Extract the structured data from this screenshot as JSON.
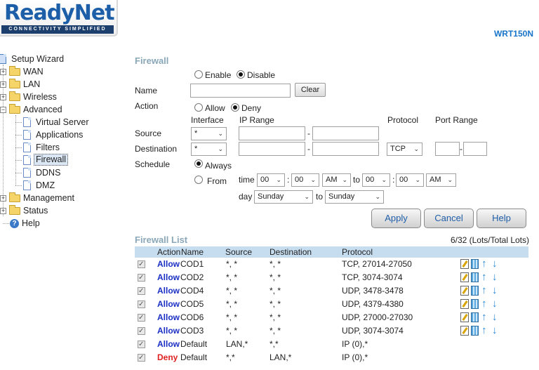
{
  "header": {
    "logo_text_1": "Ready",
    "logo_text_2": "Net",
    "logo_tagline": "CONNECTIVITY SIMPLIFIED",
    "model": "WRT150N"
  },
  "sidebar": {
    "setup_wizard": "Setup Wizard",
    "wan": "WAN",
    "lan": "LAN",
    "wireless": "Wireless",
    "advanced": "Advanced",
    "virtual_server": "Virtual Server",
    "applications": "Applications",
    "filters": "Filters",
    "firewall": "Firewall",
    "ddns": "DDNS",
    "dmz": "DMZ",
    "management": "Management",
    "status": "Status",
    "help": "Help"
  },
  "form": {
    "title": "Firewall",
    "enable": "Enable",
    "disable": "Disable",
    "name_label": "Name",
    "name_value": "",
    "clear": "Clear",
    "action_label": "Action",
    "allow": "Allow",
    "deny": "Deny",
    "col_interface": "Interface",
    "col_ip_range": "IP Range",
    "col_protocol": "Protocol",
    "col_port_range": "Port Range",
    "source_label": "Source",
    "destination_label": "Destination",
    "source_interface": "*",
    "destination_interface": "*",
    "dash": "-",
    "protocol": "TCP",
    "schedule_label": "Schedule",
    "always": "Always",
    "from": "From",
    "time_label": "time",
    "to": "to",
    "colon": ":",
    "hour_from": "00",
    "min_from": "00",
    "ampm_from": "AM",
    "hour_to": "00",
    "min_to": "00",
    "ampm_to": "AM",
    "day_label": "day",
    "day_from": "Sunday",
    "day_to": "Sunday"
  },
  "buttons": {
    "apply": "Apply",
    "cancel": "Cancel",
    "help": "Help"
  },
  "list": {
    "title": "Firewall List",
    "lots": "6/32 (Lots/Total Lots)",
    "headers": {
      "action": "Action",
      "name": "Name",
      "source": "Source",
      "destination": "Destination",
      "protocol": "Protocol"
    },
    "rows": [
      {
        "action": "Allow",
        "name": "COD1",
        "source": "*, *",
        "destination": "*, *",
        "protocol": "TCP, 27014-27050",
        "icons": true
      },
      {
        "action": "Allow",
        "name": "COD2",
        "source": "*, *",
        "destination": "*, *",
        "protocol": "TCP, 3074-3074",
        "icons": true
      },
      {
        "action": "Allow",
        "name": "COD4",
        "source": "*, *",
        "destination": "*, *",
        "protocol": "UDP, 3478-3478",
        "icons": true
      },
      {
        "action": "Allow",
        "name": "COD5",
        "source": "*, *",
        "destination": "*, *",
        "protocol": "UDP, 4379-4380",
        "icons": true
      },
      {
        "action": "Allow",
        "name": "COD6",
        "source": "*, *",
        "destination": "*, *",
        "protocol": "UDP, 27000-27030",
        "icons": true
      },
      {
        "action": "Allow",
        "name": "COD3",
        "source": "*, *",
        "destination": "*, *",
        "protocol": "UDP, 3074-3074",
        "icons": true
      },
      {
        "action": "Allow",
        "name": "Default",
        "source": "LAN,*",
        "destination": "*,*",
        "protocol": "IP (0),*",
        "icons": false
      },
      {
        "action": "Deny",
        "name": "Default",
        "source": "*,*",
        "destination": "LAN,*",
        "protocol": "IP (0),*",
        "icons": false
      }
    ]
  }
}
